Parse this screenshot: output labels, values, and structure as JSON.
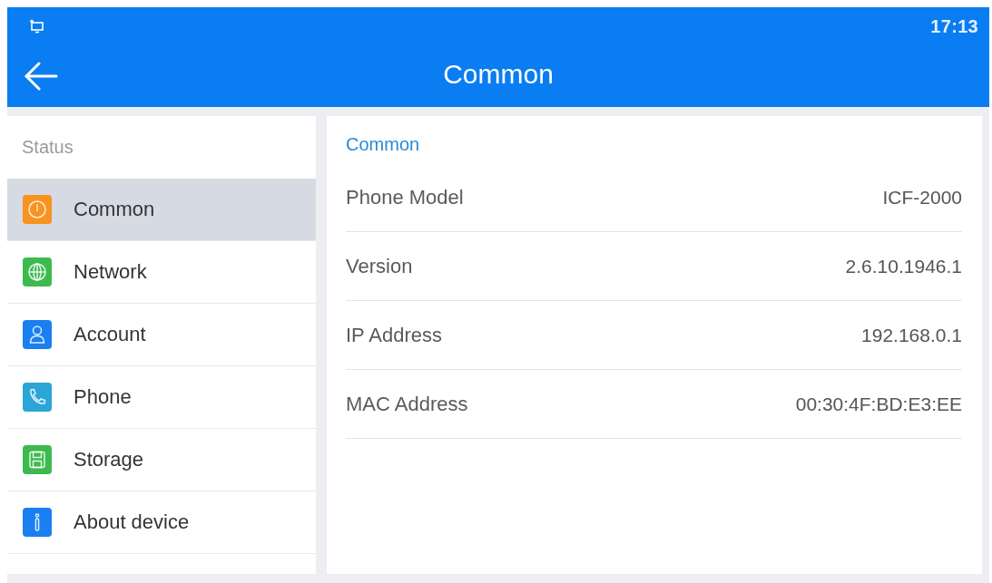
{
  "status_bar": {
    "time": "17:13"
  },
  "header": {
    "title": "Common"
  },
  "sidebar": {
    "section": "Status",
    "items": [
      {
        "label": "Common",
        "kind": "alert",
        "color": "#f7931e",
        "selected": true
      },
      {
        "label": "Network",
        "kind": "globe",
        "color": "#3dba4e",
        "selected": false
      },
      {
        "label": "Account",
        "kind": "person",
        "color": "#1a7ff0",
        "selected": false
      },
      {
        "label": "Phone",
        "kind": "handset",
        "color": "#2aa5d8",
        "selected": false
      },
      {
        "label": "Storage",
        "kind": "floppy",
        "color": "#3dba4e",
        "selected": false
      },
      {
        "label": "About device",
        "kind": "info",
        "color": "#1a7ff0",
        "selected": false
      }
    ]
  },
  "detail": {
    "heading": "Common",
    "rows": [
      {
        "label": "Phone Model",
        "value": "ICF-2000"
      },
      {
        "label": "Version",
        "value": "2.6.10.1946.1"
      },
      {
        "label": "IP Address",
        "value": "192.168.0.1"
      },
      {
        "label": "MAC Address",
        "value": "00:30:4F:BD:E3:EE"
      }
    ]
  }
}
